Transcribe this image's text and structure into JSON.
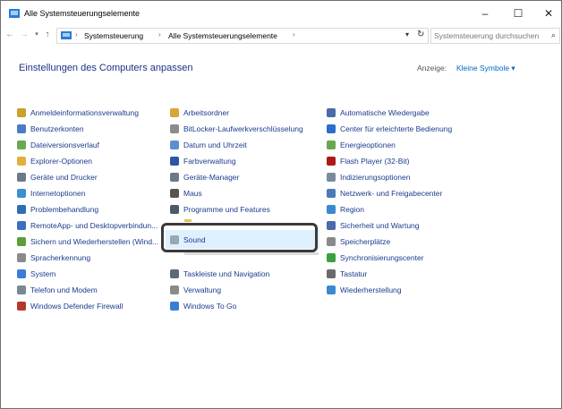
{
  "window": {
    "title": "Alle Systemsteuerungselemente",
    "controls": {
      "minimize": "–",
      "maximize": "☐",
      "close": "✕"
    }
  },
  "address": {
    "crumbs": [
      "Systemsteuerung",
      "Alle Systemsteuerungselemente"
    ],
    "separator": "›"
  },
  "search": {
    "placeholder": "Systemsteuerung durchsuchen"
  },
  "heading": "Einstellungen des Computers anpassen",
  "view": {
    "label": "Anzeige:",
    "value": "Kleine Symbole ▾"
  },
  "columns": [
    [
      {
        "label": "Anmeldeinformationsverwaltung",
        "icon": "credential-icon",
        "color": "#c9a227"
      },
      {
        "label": "Benutzerkonten",
        "icon": "users-icon",
        "color": "#4a7bc8"
      },
      {
        "label": "Dateiversionsverlauf",
        "icon": "file-history-icon",
        "color": "#6aa84f"
      },
      {
        "label": "Explorer-Optionen",
        "icon": "folder-options-icon",
        "color": "#e0b040"
      },
      {
        "label": "Geräte und Drucker",
        "icon": "printer-icon",
        "color": "#6b7a8a"
      },
      {
        "label": "Internetoptionen",
        "icon": "internet-icon",
        "color": "#3c8fd0"
      },
      {
        "label": "Problembehandlung",
        "icon": "troubleshoot-icon",
        "color": "#2f6db5"
      },
      {
        "label": "RemoteApp- und Desktopverbindun...",
        "icon": "remoteapp-icon",
        "color": "#3b6fbf"
      },
      {
        "label": "Sichern und Wiederherstellen (Wind...",
        "icon": "backup-icon",
        "color": "#5b9e3a"
      },
      {
        "label": "Spracherkennung",
        "icon": "microphone-icon",
        "color": "#8a8a8a"
      },
      {
        "label": "System",
        "icon": "system-icon",
        "color": "#3a7dd8"
      },
      {
        "label": "Telefon und Modem",
        "icon": "phone-modem-icon",
        "color": "#7a8894"
      },
      {
        "label": "Windows Defender Firewall",
        "icon": "firewall-icon",
        "color": "#b23a2a"
      }
    ],
    [
      {
        "label": "Arbeitsordner",
        "icon": "work-folders-icon",
        "color": "#d9a33a"
      },
      {
        "label": "BitLocker-Laufwerkverschlüsselung",
        "icon": "bitlocker-icon",
        "color": "#8c8c8c"
      },
      {
        "label": "Datum und Uhrzeit",
        "icon": "clock-icon",
        "color": "#5a8fd0"
      },
      {
        "label": "Farbverwaltung",
        "icon": "color-management-icon",
        "color": "#2a56a8"
      },
      {
        "label": "Geräte-Manager",
        "icon": "device-manager-icon",
        "color": "#6a7a8a"
      },
      {
        "label": "Maus",
        "icon": "mouse-icon",
        "color": "#555555"
      },
      {
        "label": "Programme und Features",
        "icon": "programs-icon",
        "color": "#4c5a68"
      },
      {
        "label": "",
        "icon": "",
        "color": "#ffffff"
      },
      {
        "label": "",
        "icon": "",
        "color": "#ffffff"
      },
      {
        "label": "",
        "icon": "",
        "color": "#ffffff"
      },
      {
        "label": "Taskleiste und Navigation",
        "icon": "taskbar-icon",
        "color": "#5a6a7a"
      },
      {
        "label": "Verwaltung",
        "icon": "admin-tools-icon",
        "color": "#8a8a8a"
      },
      {
        "label": "Windows To Go",
        "icon": "windows-to-go-icon",
        "color": "#3a7dd8"
      }
    ],
    [
      {
        "label": "Automatische Wiedergabe",
        "icon": "autoplay-icon",
        "color": "#4a6aa8"
      },
      {
        "label": "Center für erleichterte Bedienung",
        "icon": "ease-of-access-icon",
        "color": "#2a6ec8"
      },
      {
        "label": "Energieoptionen",
        "icon": "power-icon",
        "color": "#6aa84f"
      },
      {
        "label": "Flash Player (32-Bit)",
        "icon": "flash-icon",
        "color": "#b01818"
      },
      {
        "label": "Indizierungsoptionen",
        "icon": "indexing-icon",
        "color": "#7a8a9a"
      },
      {
        "label": "Netzwerk- und Freigabecenter",
        "icon": "network-icon",
        "color": "#4a7ab8"
      },
      {
        "label": "Region",
        "icon": "region-icon",
        "color": "#3a8ad0"
      },
      {
        "label": "Sicherheit und Wartung",
        "icon": "flag-icon",
        "color": "#4a6aa8"
      },
      {
        "label": "Speicherplätze",
        "icon": "storage-spaces-icon",
        "color": "#8a8a8a"
      },
      {
        "label": "Synchronisierungscenter",
        "icon": "sync-icon",
        "color": "#3aa040"
      },
      {
        "label": "Tastatur",
        "icon": "keyboard-icon",
        "color": "#6a6a6a"
      },
      {
        "label": "Wiederherstellung",
        "icon": "recovery-icon",
        "color": "#3a8ad0"
      }
    ]
  ],
  "highlighted": {
    "label": "Sound",
    "icon": "speaker-icon"
  }
}
